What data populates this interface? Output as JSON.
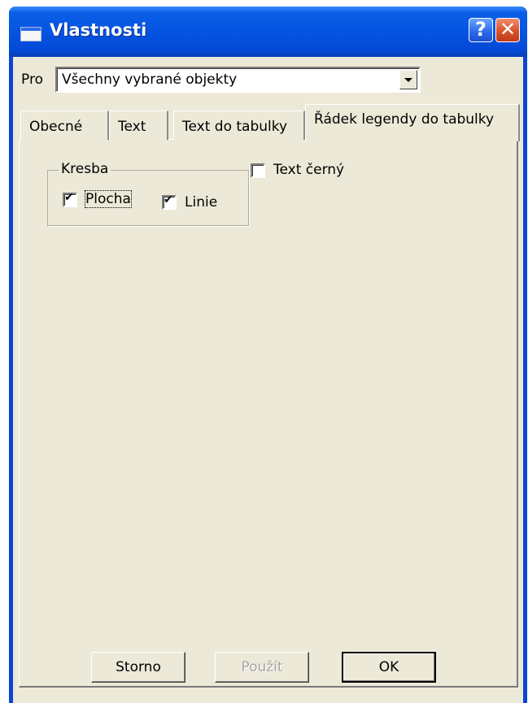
{
  "window": {
    "title": "Vlastnosti",
    "help_glyph": "?",
    "close_glyph": "✕"
  },
  "scope": {
    "label": "Pro",
    "value": "Všechny vybrané objekty"
  },
  "tabs": [
    {
      "label": "Obecné"
    },
    {
      "label": "Text"
    },
    {
      "label": "Text do tabulky"
    },
    {
      "label": "Řádek legendy do tabulky",
      "active": true
    }
  ],
  "drawing_group": {
    "title": "Kresba",
    "checkboxes": [
      {
        "label": "Plocha",
        "checked": true
      },
      {
        "label": "Linie",
        "checked": true
      }
    ]
  },
  "text_black": {
    "label": "Text černý",
    "checked": false
  },
  "buttons": {
    "cancel": "Storno",
    "apply": "Použít",
    "ok": "OK"
  }
}
